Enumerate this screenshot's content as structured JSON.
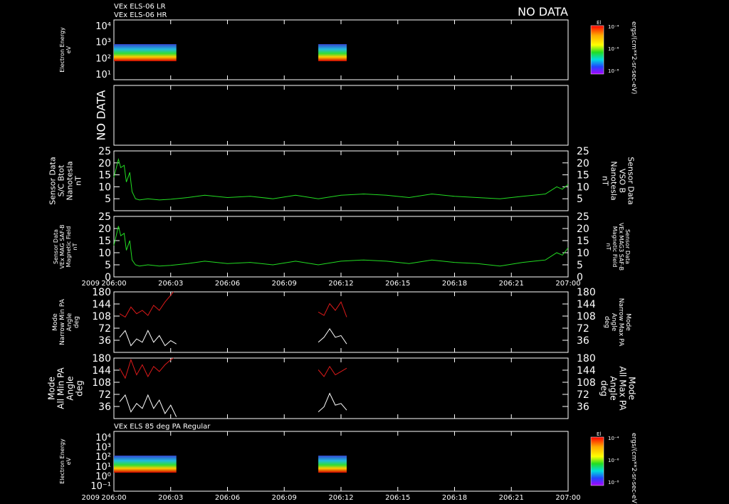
{
  "header": {
    "line1": "VEx ELS-06 LR",
    "line2": "VEx ELS-06 HR",
    "no_data": "NO DATA"
  },
  "bottom_header": "VEx ELS 85 deg PA Regular",
  "year": "2009",
  "time_ticks": [
    "206:00",
    "206:03",
    "206:06",
    "206:09",
    "206:12",
    "206:15",
    "206:18",
    "206:21",
    "207:00"
  ],
  "colors": {
    "green": "#22dd22",
    "red": "#dd1a1a",
    "white": "#ffffff"
  },
  "colorbar": {
    "top_label": "El",
    "ticks": [
      "10⁻⁴",
      "10⁻⁶",
      "10⁻⁸"
    ],
    "unit": "ergs/(cm**2-sr-sec-eV)"
  },
  "chart_data": [
    {
      "type": "heatmap",
      "ylabel": [
        "Electron Energy",
        "eV"
      ],
      "yticks": [
        "10⁴",
        "10³",
        "10²",
        "10¹"
      ],
      "data_intervals_hours": [
        [
          0,
          1.1
        ],
        [
          3.6,
          4.1
        ]
      ]
    },
    {
      "type": "line",
      "empty": true,
      "no_data_label": "NO DATA"
    },
    {
      "type": "line",
      "ylabel": [
        "Sensor Data",
        "S/C Btot",
        "Nanotesla",
        "nT"
      ],
      "ylabel_right": [
        "Sensor Data",
        "VSO B",
        "Nanotesla",
        "nT"
      ],
      "ylim": [
        0,
        25
      ],
      "yticks": [
        5,
        10,
        15,
        20,
        25
      ],
      "series_color": "green",
      "x": [
        0,
        0.08,
        0.12,
        0.18,
        0.22,
        0.28,
        0.32,
        0.38,
        0.45,
        0.6,
        0.8,
        1.0,
        1.3,
        1.6,
        2.0,
        2.4,
        2.8,
        3.2,
        3.6,
        4.0,
        4.4,
        4.8,
        5.2,
        5.6,
        6.0,
        6.4,
        6.8,
        7.2,
        7.6,
        7.8,
        7.9,
        8.0
      ],
      "y": [
        14,
        21.5,
        18,
        19,
        12,
        16,
        8,
        5,
        4.5,
        5,
        4.5,
        4.8,
        5.5,
        6.5,
        5.5,
        6,
        5,
        6.5,
        5,
        6.5,
        7,
        6.5,
        5.5,
        7,
        6,
        5.5,
        5,
        6,
        7,
        10,
        9,
        11
      ]
    },
    {
      "type": "line",
      "ylabel": [
        "Sensor Data",
        "VEx MAG SAF-B",
        "Magnetic Field",
        "nT"
      ],
      "ylabel_right": [
        "Sensor Data",
        "VEx MAG3 SAF-B",
        "Magnetic Field",
        "nT"
      ],
      "ylim": [
        0,
        25
      ],
      "yticks": [
        0,
        5,
        10,
        15,
        20,
        25
      ],
      "series_color": "green",
      "x": [
        0,
        0.08,
        0.12,
        0.18,
        0.22,
        0.28,
        0.32,
        0.38,
        0.45,
        0.6,
        0.8,
        1.0,
        1.3,
        1.6,
        2.0,
        2.4,
        2.8,
        3.2,
        3.6,
        4.0,
        4.4,
        4.8,
        5.2,
        5.6,
        6.0,
        6.4,
        6.8,
        7.2,
        7.6,
        7.8,
        7.9,
        8.0
      ],
      "y": [
        13,
        21,
        17,
        18,
        11,
        15,
        7,
        5,
        4.5,
        5,
        4.5,
        4.8,
        5.5,
        6.5,
        5.5,
        6,
        5,
        6.5,
        5,
        6.5,
        7,
        6.5,
        5.5,
        7,
        6,
        5.5,
        4.5,
        6,
        7,
        10,
        9,
        12
      ]
    },
    {
      "type": "line",
      "ylabel": [
        "Mode",
        "Narrow Min PA",
        "Angle",
        "deg"
      ],
      "ylabel_right": [
        "Mode",
        "Narrow Max PA",
        "Angle",
        "deg"
      ],
      "ylim": [
        0,
        180
      ],
      "yticks": [
        36,
        72,
        108,
        144,
        180
      ],
      "series": [
        {
          "color": "red",
          "segments": [
            {
              "x": [
                0.1,
                0.2,
                0.3,
                0.4,
                0.5,
                0.6,
                0.7,
                0.8,
                0.9,
                1.0,
                1.05
              ],
              "y": [
                115,
                105,
                135,
                115,
                125,
                110,
                140,
                125,
                150,
                170,
                180
              ]
            },
            {
              "x": [
                3.6,
                3.7,
                3.8,
                3.9,
                4.0,
                4.1
              ],
              "y": [
                120,
                110,
                145,
                125,
                150,
                105
              ]
            }
          ]
        },
        {
          "color": "white",
          "segments": [
            {
              "x": [
                0.1,
                0.2,
                0.3,
                0.4,
                0.5,
                0.6,
                0.7,
                0.8,
                0.9,
                1.0,
                1.1
              ],
              "y": [
                45,
                65,
                20,
                40,
                30,
                65,
                30,
                50,
                20,
                35,
                25
              ]
            },
            {
              "x": [
                3.6,
                3.7,
                3.8,
                3.9,
                4.0,
                4.1
              ],
              "y": [
                30,
                45,
                70,
                45,
                50,
                25
              ]
            }
          ]
        }
      ]
    },
    {
      "type": "line",
      "ylabel": [
        "Mode",
        "All Min PA",
        "Angle",
        "deg"
      ],
      "ylabel_right": [
        "Mode",
        "All Max PA",
        "Angle",
        "deg"
      ],
      "ylim": [
        0,
        180
      ],
      "yticks": [
        36,
        72,
        108,
        144,
        180
      ],
      "series": [
        {
          "color": "red",
          "segments": [
            {
              "x": [
                0.1,
                0.2,
                0.3,
                0.4,
                0.5,
                0.6,
                0.7,
                0.8,
                0.9,
                1.0,
                1.05
              ],
              "y": [
                150,
                120,
                175,
                130,
                160,
                125,
                155,
                140,
                160,
                175,
                180
              ]
            },
            {
              "x": [
                3.6,
                3.7,
                3.8,
                3.9,
                4.0,
                4.1
              ],
              "y": [
                145,
                125,
                155,
                130,
                140,
                150
              ]
            }
          ]
        },
        {
          "color": "white",
          "segments": [
            {
              "x": [
                0.1,
                0.2,
                0.3,
                0.4,
                0.5,
                0.6,
                0.7,
                0.8,
                0.9,
                1.0,
                1.1
              ],
              "y": [
                50,
                70,
                20,
                45,
                30,
                70,
                30,
                55,
                15,
                40,
                5
              ]
            },
            {
              "x": [
                3.6,
                3.7,
                3.8,
                3.9,
                4.0,
                4.1
              ],
              "y": [
                20,
                35,
                75,
                40,
                45,
                25
              ]
            }
          ]
        }
      ]
    },
    {
      "type": "heatmap",
      "ylabel": [
        "Electron Energy",
        "eV"
      ],
      "yticks": [
        "10⁴",
        "10³",
        "10²",
        "10¹",
        "10⁰",
        "10⁻¹"
      ],
      "data_intervals_hours": [
        [
          0,
          1.1
        ],
        [
          3.6,
          4.1
        ]
      ]
    }
  ]
}
